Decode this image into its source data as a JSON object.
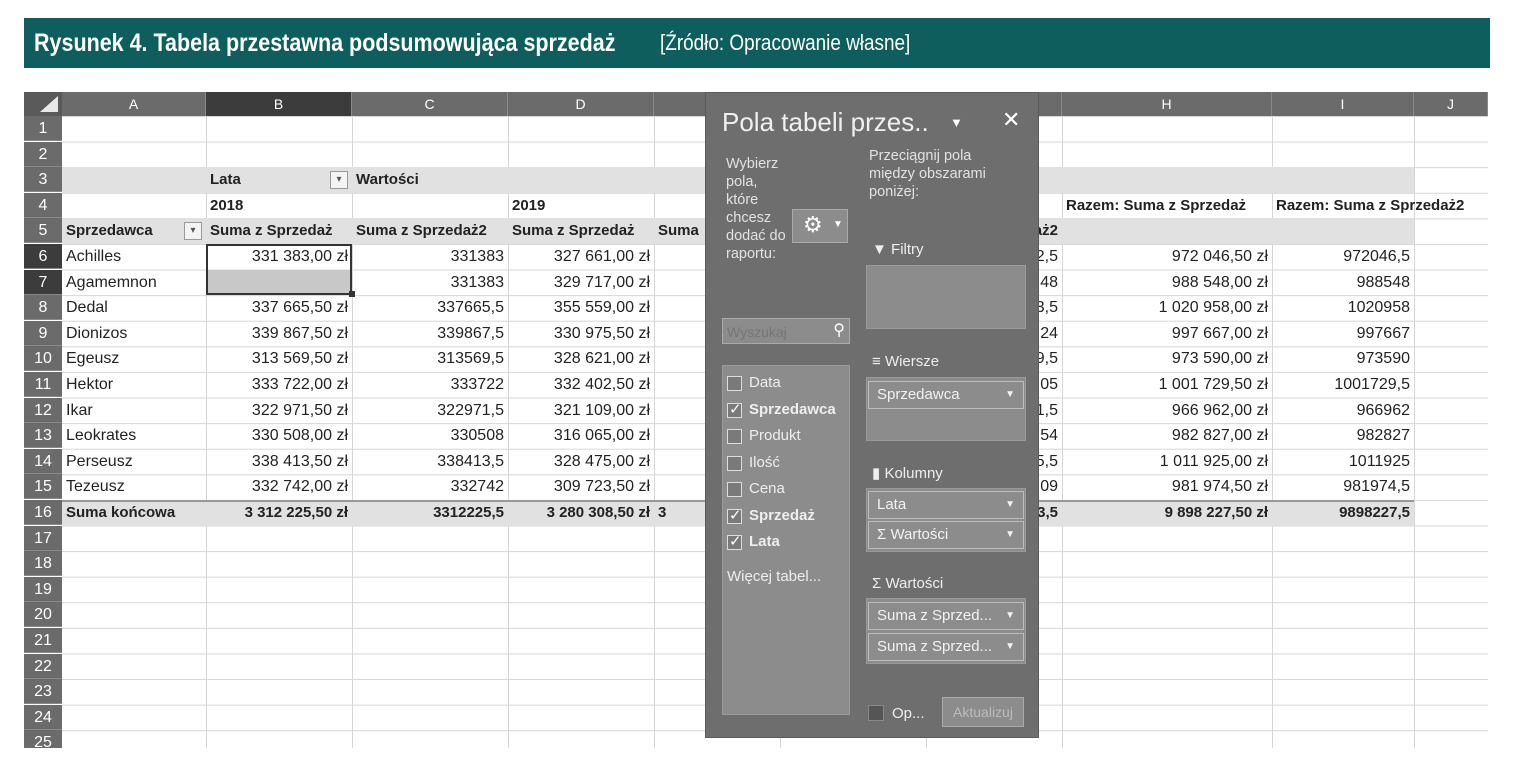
{
  "caption": {
    "bold": "Rysunek 4. Tabela przestawna podsumowująca sprzedaż",
    "source": "[Źródło: Opracowanie własne]"
  },
  "columns": [
    "A",
    "B",
    "C",
    "D",
    "E",
    "F",
    "G",
    "H",
    "I",
    "J"
  ],
  "rows": [
    "1",
    "2",
    "3",
    "4",
    "5",
    "6",
    "7",
    "8",
    "9",
    "10",
    "11",
    "12",
    "13",
    "14",
    "15",
    "16",
    "17",
    "18",
    "19",
    "20",
    "21",
    "22",
    "23",
    "24",
    "25"
  ],
  "pivot": {
    "lata_label": "Lata",
    "wartosci_label": "Wartości",
    "year1": "2018",
    "year2": "2019",
    "row_header": "Sprzedawca",
    "col_b": "Suma z Sprzedaż",
    "col_c": "Suma z Sprzedaż2",
    "col_d": "Suma z Sprzedaż",
    "col_e": "Suma",
    "col_g_partial": "daż2",
    "col_h": "Razem: Suma z Sprzedaż",
    "col_i": "Razem: Suma z Sprzedaż2",
    "data": [
      {
        "name": "Achilles",
        "b": "331 383,00 zł",
        "c": "331383",
        "d": "327 661,00 zł",
        "g": "2,5",
        "h": "972 046,50 zł",
        "i": "972046,5"
      },
      {
        "name": "Agamemnon",
        "b": "331 383,00 zł",
        "c": "331383",
        "d": "329 717,00 zł",
        "g": "48",
        "h": "988 548,00 zł",
        "i": "988548"
      },
      {
        "name": "Dedal",
        "b": "337 665,50 zł",
        "c": "337665,5",
        "d": "355 559,00 zł",
        "g": "3,5",
        "h": "1 020 958,00 zł",
        "i": "1020958"
      },
      {
        "name": "Dionizos",
        "b": "339 867,50 zł",
        "c": "339867,5",
        "d": "330 975,50 zł",
        "g": "24",
        "h": "997 667,00 zł",
        "i": "997667"
      },
      {
        "name": "Egeusz",
        "b": "313 569,50 zł",
        "c": "313569,5",
        "d": "328 621,00 zł",
        "g": "9,5",
        "h": "973 590,00 zł",
        "i": "973590"
      },
      {
        "name": "Hektor",
        "b": "333 722,00 zł",
        "c": "333722",
        "d": "332 402,50 zł",
        "g": "05",
        "h": "1 001 729,50 zł",
        "i": "1001729,5"
      },
      {
        "name": "Ikar",
        "b": "322 971,50 zł",
        "c": "322971,5",
        "d": "321 109,00 zł",
        "g": "1,5",
        "h": "966 962,00 zł",
        "i": "966962"
      },
      {
        "name": "Leokrates",
        "b": "330 508,00 zł",
        "c": "330508",
        "d": "316 065,00 zł",
        "g": "54",
        "h": "982 827,00 zł",
        "i": "982827"
      },
      {
        "name": "Perseusz",
        "b": "338 413,50 zł",
        "c": "338413,5",
        "d": "328 475,00 zł",
        "g": "5,5",
        "h": "1 011 925,00 zł",
        "i": "1011925"
      },
      {
        "name": "Tezeusz",
        "b": "332 742,00 zł",
        "c": "332742",
        "d": "309 723,50 zł",
        "g": "09",
        "h": "981 974,50 zł",
        "i": "981974,5"
      }
    ],
    "total": {
      "name": "Suma końcowa",
      "b": "3 312 225,50 zł",
      "c": "3312225,5",
      "d": "3 280 308,50 zł",
      "e": "3",
      "g": "3,5",
      "h": "9 898 227,50 zł",
      "i": "9898227,5"
    }
  },
  "pane": {
    "title": "Pola tabeli przes..",
    "choose_text": "Wybierz pola, które chcesz dodać do raportu:",
    "drag_text": "Przeciągnij pola między obszarami poniżej:",
    "search_placeholder": "Wyszukaj",
    "fields": [
      {
        "label": "Data",
        "checked": false
      },
      {
        "label": "Sprzedawca",
        "checked": true
      },
      {
        "label": "Produkt",
        "checked": false
      },
      {
        "label": "Ilość",
        "checked": false
      },
      {
        "label": "Cena",
        "checked": false
      },
      {
        "label": "Sprzedaż",
        "checked": true
      },
      {
        "label": "Lata",
        "checked": true
      }
    ],
    "more_tables": "Więcej tabel...",
    "filters_label": "Filtry",
    "rows_label": "Wiersze",
    "rows_item": "Sprzedawca",
    "columns_label": "Kolumny",
    "columns_item1": "Lata",
    "columns_item2": "Σ Wartości",
    "values_label": "Wartości",
    "values_item1": "Suma z Sprzed...",
    "values_item2": "Suma z Sprzed...",
    "defer_label": "Op...",
    "update_button": "Aktualizuj"
  }
}
